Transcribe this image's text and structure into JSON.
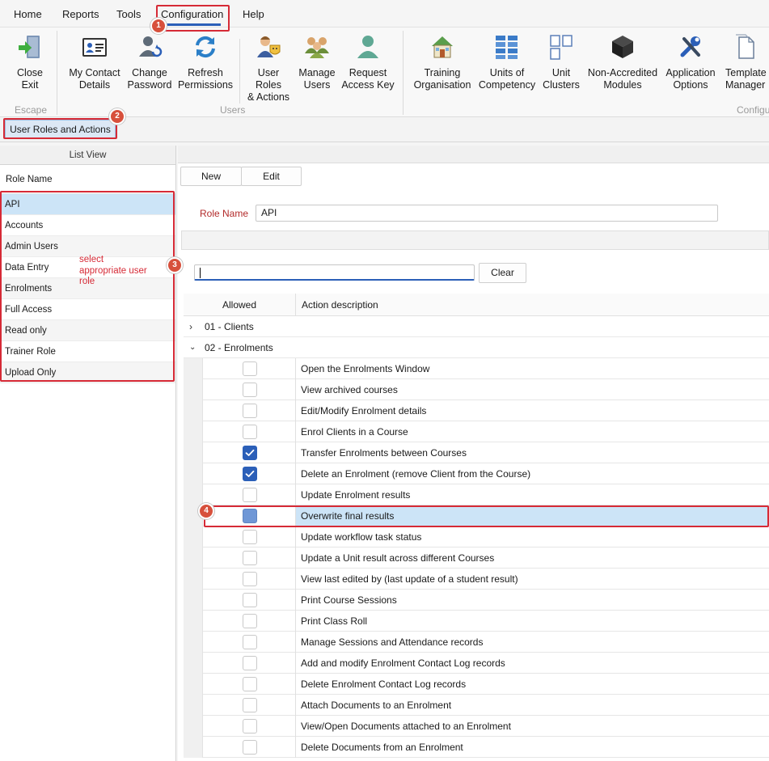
{
  "menu": {
    "items": [
      "Home",
      "Reports",
      "Tools",
      "Configuration",
      "Help"
    ]
  },
  "ribbon": {
    "close_exit": [
      "Close",
      "Exit"
    ],
    "escape_group": "Escape",
    "my_contact": [
      "My Contact",
      "Details"
    ],
    "change_password": [
      "Change",
      "Password"
    ],
    "refresh_permissions": [
      "Refresh",
      "Permissions"
    ],
    "user_roles": [
      "User Roles",
      "& Actions"
    ],
    "manage_users": [
      "Manage",
      "Users"
    ],
    "request_key": [
      "Request",
      "Access Key"
    ],
    "users_group": "Users",
    "training_org": [
      "Training",
      "Organisation"
    ],
    "units_comp": [
      "Units of",
      "Competency"
    ],
    "unit_clusters": [
      "Unit",
      "Clusters"
    ],
    "non_accredited": [
      "Non-Accredited",
      "Modules"
    ],
    "app_options": [
      "Application",
      "Options"
    ],
    "template_manager": [
      "Template",
      "Manager"
    ],
    "config_group": "Configu"
  },
  "tab": {
    "label": "User Roles and Actions"
  },
  "annotations": {
    "b1": "1",
    "b2": "2",
    "b3": "3",
    "b4": "4",
    "note": "select appropriate user role"
  },
  "list_view": {
    "header": "List View",
    "column": "Role Name",
    "roles": [
      "API",
      "Accounts",
      "Admin Users",
      "Data Entry",
      "Enrolments",
      "Full Access",
      "Read only",
      "Trainer Role",
      "Upload Only"
    ]
  },
  "form": {
    "new_label": "New",
    "edit_label": "Edit",
    "role_name_label": "Role Name",
    "role_name_value": "API",
    "clear_label": "Clear"
  },
  "grid": {
    "col_allowed": "Allowed",
    "col_desc": "Action description",
    "group_collapsed": "01 - Clients",
    "group_expanded": "02 - Enrolments",
    "rows": [
      {
        "label": "Open the Enrolments Window",
        "allowed": false
      },
      {
        "label": "View archived courses",
        "allowed": false
      },
      {
        "label": "Edit/Modify Enrolment details",
        "allowed": false
      },
      {
        "label": "Enrol Clients in a Course",
        "allowed": false
      },
      {
        "label": "Transfer Enrolments between Courses",
        "allowed": true
      },
      {
        "label": "Delete an Enrolment (remove Client from the Course)",
        "allowed": true
      },
      {
        "label": "Update Enrolment results",
        "allowed": false
      },
      {
        "label": "Overwrite final results",
        "allowed": false
      },
      {
        "label": "Update workflow task status",
        "allowed": false
      },
      {
        "label": "Update a Unit result across different Courses",
        "allowed": false
      },
      {
        "label": "View last edited by (last update of a student result)",
        "allowed": false
      },
      {
        "label": "Print Course Sessions",
        "allowed": false
      },
      {
        "label": "Print Class Roll",
        "allowed": false
      },
      {
        "label": "Manage Sessions and Attendance records",
        "allowed": false
      },
      {
        "label": "Add and modify Enrolment Contact Log records",
        "allowed": false
      },
      {
        "label": "Delete Enrolment Contact Log records",
        "allowed": false
      },
      {
        "label": "Attach Documents to an Enrolment",
        "allowed": false
      },
      {
        "label": "View/Open Documents attached to an Enrolment",
        "allowed": false
      },
      {
        "label": "Delete Documents from an Enrolment",
        "allowed": false
      }
    ]
  }
}
